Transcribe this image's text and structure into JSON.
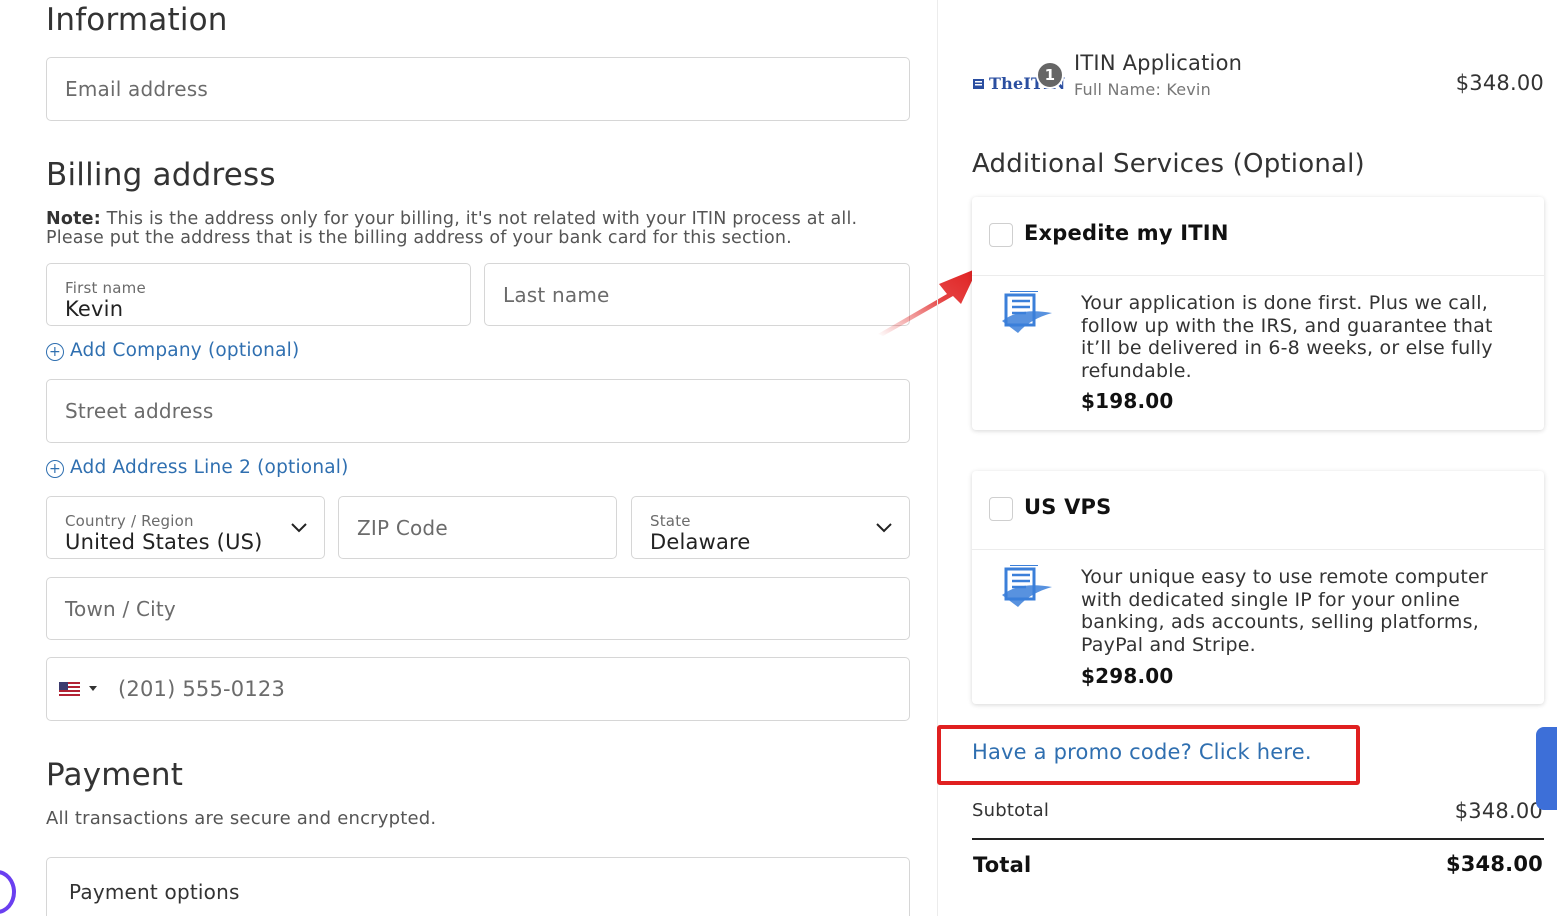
{
  "information": {
    "heading": "Information",
    "email_placeholder": "Email address"
  },
  "billing": {
    "heading": "Billing address",
    "note_label": "Note:",
    "note_line1": " This is the address only for your billing, it's not related with your ITIN process at all.",
    "note_line2": "Please put the address that is the billing address of your bank card for this section.",
    "first_name_label": "First name",
    "first_name_value": "Kevin",
    "last_name_placeholder": "Last name",
    "add_company_link": "Add Company (optional)",
    "street_placeholder": "Street address",
    "add_address2_link": "Add Address Line 2 (optional)",
    "country_label": "Country / Region",
    "country_value": "United States (US)",
    "zip_placeholder": "ZIP Code",
    "state_label": "State",
    "state_value": "Delaware",
    "city_placeholder": "Town / City",
    "phone_placeholder": "(201) 555-0123",
    "phone_flag_icon": "us-flag-icon"
  },
  "payment": {
    "heading": "Payment",
    "subtitle": "All transactions are secure and encrypted.",
    "options_label": "Payment options"
  },
  "order": {
    "logo_text": "TheITIN",
    "item_quantity": "1",
    "item_title": "ITIN Application",
    "item_subtitle": "Full Name: Kevin",
    "item_price": "$348.00"
  },
  "additional_services": {
    "heading": "Additional Services (Optional)",
    "services": [
      {
        "title": "Expedite my ITIN",
        "description": "Your application is done first. Plus we call, follow up with the IRS, and guarantee that it’ll be delivered in 6-8 weeks, or else fully refundable.",
        "price": "$198.00",
        "checked": false
      },
      {
        "title": "US VPS",
        "description": "Your unique easy to use remote computer with dedicated single IP for your online banking, ads accounts, selling platforms, PayPal and Stripe.",
        "price": "$298.00",
        "checked": false
      }
    ]
  },
  "summary": {
    "promo_link": "Have a promo code? Click here.",
    "subtotal_label": "Subtotal",
    "subtotal_value": "$348.00",
    "total_label": "Total",
    "total_value": "$348.00"
  },
  "colors": {
    "link": "#2f6fb0",
    "highlight_box": "#e02020",
    "annotation_arrow": "#e02020",
    "side_tab": "#3d6fd8"
  }
}
